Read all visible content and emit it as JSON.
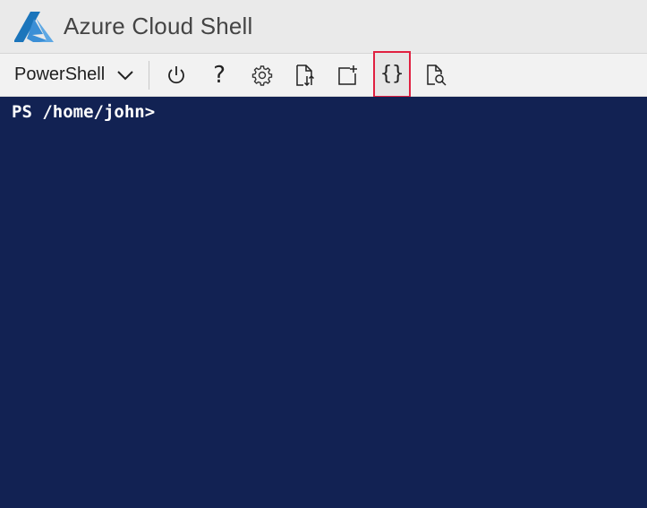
{
  "window": {
    "title": "Azure Cloud Shell",
    "logo": "azure-logo"
  },
  "toolbar": {
    "shell_selector": {
      "value": "PowerShell",
      "icon": "chevron-down-icon"
    },
    "buttons": [
      {
        "name": "restart",
        "icon": "power-icon"
      },
      {
        "name": "help",
        "icon": "question-mark-icon",
        "glyph": "?"
      },
      {
        "name": "settings",
        "icon": "gear-icon"
      },
      {
        "name": "upload-download",
        "icon": "file-transfer-icon"
      },
      {
        "name": "new-session",
        "icon": "new-session-icon"
      },
      {
        "name": "editor",
        "icon": "braces-icon",
        "glyph": "{}",
        "highlighted": true
      },
      {
        "name": "web-preview",
        "icon": "file-search-icon"
      }
    ]
  },
  "terminal": {
    "prompt": "PS /home/john>"
  },
  "colors": {
    "terminal_bg": "#122253",
    "highlight_border": "#e02040",
    "azure_blue": "#0072c6"
  }
}
